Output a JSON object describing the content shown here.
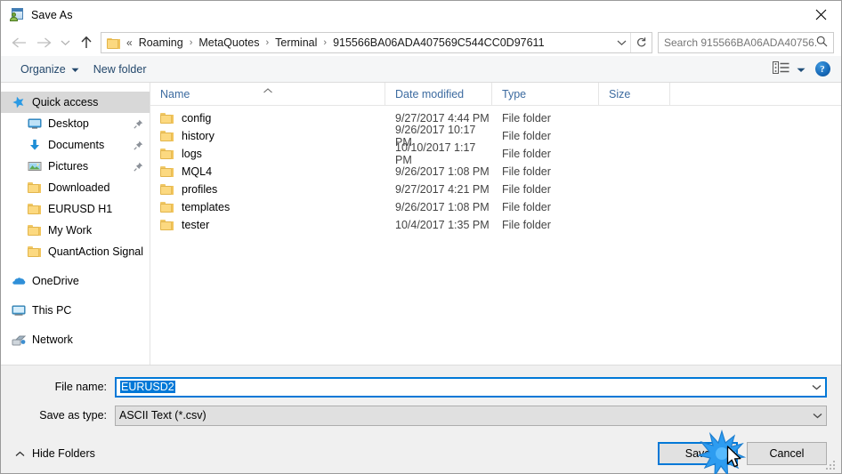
{
  "window": {
    "title": "Save As",
    "icon": "save-as-app-icon",
    "close_label": "✕"
  },
  "nav": {
    "back_icon": "arrow-left-icon",
    "forward_icon": "arrow-right-icon",
    "recent_icon": "chevron-down-icon",
    "up_icon": "arrow-up-icon",
    "refresh_icon": "refresh-icon",
    "address_dropdown_icon": "chevron-down-icon",
    "breadcrumb_prefix": "«",
    "breadcrumbs": [
      "Roaming",
      "MetaQuotes",
      "Terminal",
      "915566BA06ADA407569C544CC0D97611"
    ],
    "separator": "›"
  },
  "search": {
    "placeholder": "Search 915566BA06ADA40756...",
    "icon": "search-icon"
  },
  "toolbar": {
    "organize_label": "Organize",
    "organize_caret": "▼",
    "new_folder_label": "New folder",
    "view_icon": "list-view-icon",
    "view_caret": "▼",
    "help_label": "?",
    "help_icon": "help-icon"
  },
  "sidebar": {
    "items": [
      {
        "label": "Quick access",
        "icon": "star-icon",
        "level": 0,
        "selected": true,
        "pinned": false
      },
      {
        "label": "Desktop",
        "icon": "monitor-icon",
        "level": 1,
        "selected": false,
        "pinned": true
      },
      {
        "label": "Documents",
        "icon": "download-arrow-icon",
        "level": 1,
        "selected": false,
        "pinned": true
      },
      {
        "label": "Pictures",
        "icon": "picture-icon",
        "level": 1,
        "selected": false,
        "pinned": true
      },
      {
        "label": "Downloaded",
        "icon": "folder-icon",
        "level": 1,
        "selected": false,
        "pinned": false
      },
      {
        "label": "EURUSD H1",
        "icon": "folder-icon",
        "level": 1,
        "selected": false,
        "pinned": false
      },
      {
        "label": "My Work",
        "icon": "folder-icon",
        "level": 1,
        "selected": false,
        "pinned": false
      },
      {
        "label": "QuantAction Signal",
        "icon": "folder-icon",
        "level": 1,
        "selected": false,
        "pinned": false
      },
      {
        "label": "OneDrive",
        "icon": "onedrive-cloud-icon",
        "level": 0,
        "selected": false,
        "pinned": false,
        "gap_before": true
      },
      {
        "label": "This PC",
        "icon": "this-pc-icon",
        "level": 0,
        "selected": false,
        "pinned": false,
        "gap_before": true
      },
      {
        "label": "Network",
        "icon": "network-icon",
        "level": 0,
        "selected": false,
        "pinned": false,
        "gap_before": true
      }
    ]
  },
  "filelist": {
    "columns": [
      {
        "key": "name",
        "label": "Name",
        "sorted": "asc",
        "sort_icon": "caret-up-icon"
      },
      {
        "key": "date",
        "label": "Date modified"
      },
      {
        "key": "type",
        "label": "Type"
      },
      {
        "key": "size",
        "label": "Size"
      }
    ],
    "rows": [
      {
        "name": "config",
        "date": "9/27/2017 4:44 PM",
        "type": "File folder",
        "size": "",
        "icon": "folder-icon"
      },
      {
        "name": "history",
        "date": "9/26/2017 10:17 PM",
        "type": "File folder",
        "size": "",
        "icon": "folder-icon"
      },
      {
        "name": "logs",
        "date": "10/10/2017 1:17 PM",
        "type": "File folder",
        "size": "",
        "icon": "folder-icon"
      },
      {
        "name": "MQL4",
        "date": "9/26/2017 1:08 PM",
        "type": "File folder",
        "size": "",
        "icon": "folder-icon"
      },
      {
        "name": "profiles",
        "date": "9/27/2017 4:21 PM",
        "type": "File folder",
        "size": "",
        "icon": "folder-icon"
      },
      {
        "name": "templates",
        "date": "9/26/2017 1:08 PM",
        "type": "File folder",
        "size": "",
        "icon": "folder-icon"
      },
      {
        "name": "tester",
        "date": "10/4/2017 1:35 PM",
        "type": "File folder",
        "size": "",
        "icon": "folder-icon"
      }
    ]
  },
  "form": {
    "filename_label": "File name:",
    "filename_value": "EURUSD2",
    "filename_selected": true,
    "filetype_label": "Save as type:",
    "filetype_value": "ASCII Text (*.csv)",
    "dropdown_icon": "chevron-down-icon"
  },
  "footer": {
    "hide_folders_label": "Hide Folders",
    "hide_folders_icon": "chevron-up-icon",
    "save_label": "Save",
    "cancel_label": "Cancel",
    "save_is_default": true,
    "resize_grip_icon": "resize-grip-icon",
    "cursor_icon": "mouse-pointer-icon",
    "click_effect_icon": "click-burst-icon"
  },
  "colors": {
    "accent": "#0078d7",
    "folder_yellow": "#fcd980",
    "header_blue": "#3c6ba0",
    "selection_grey": "#d8d8d8",
    "dialog_grey": "#f0f0f0"
  }
}
